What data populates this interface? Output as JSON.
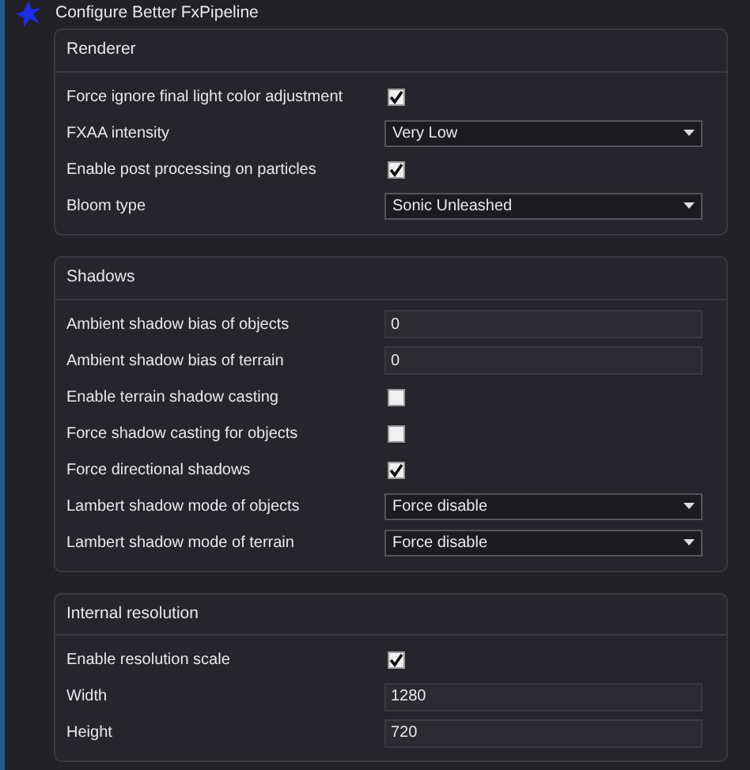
{
  "window": {
    "title": "Configure Better FxPipeline"
  },
  "groups": [
    {
      "title": "Renderer",
      "rows": [
        {
          "kind": "checkbox",
          "label": "Force ignore final light color adjustment",
          "checked": true
        },
        {
          "kind": "select",
          "label": "FXAA intensity",
          "value": "Very Low"
        },
        {
          "kind": "checkbox",
          "label": "Enable post processing on particles",
          "checked": true
        },
        {
          "kind": "select",
          "label": "Bloom type",
          "value": "Sonic Unleashed"
        }
      ]
    },
    {
      "title": "Shadows",
      "rows": [
        {
          "kind": "text",
          "label": "Ambient shadow bias of objects",
          "value": "0"
        },
        {
          "kind": "text",
          "label": "Ambient shadow bias of terrain",
          "value": "0"
        },
        {
          "kind": "checkbox",
          "label": "Enable terrain shadow casting",
          "checked": false
        },
        {
          "kind": "checkbox",
          "label": "Force shadow casting for objects",
          "checked": false
        },
        {
          "kind": "checkbox",
          "label": "Force directional shadows",
          "checked": true
        },
        {
          "kind": "select",
          "label": "Lambert shadow mode of objects",
          "value": "Force disable"
        },
        {
          "kind": "select",
          "label": "Lambert shadow mode of terrain",
          "value": "Force disable"
        }
      ]
    },
    {
      "title": "Internal resolution",
      "rows": [
        {
          "kind": "checkbox",
          "label": "Enable resolution scale",
          "checked": true
        },
        {
          "kind": "text",
          "label": "Width",
          "value": "1280"
        },
        {
          "kind": "text",
          "label": "Height",
          "value": "720"
        }
      ]
    }
  ]
}
